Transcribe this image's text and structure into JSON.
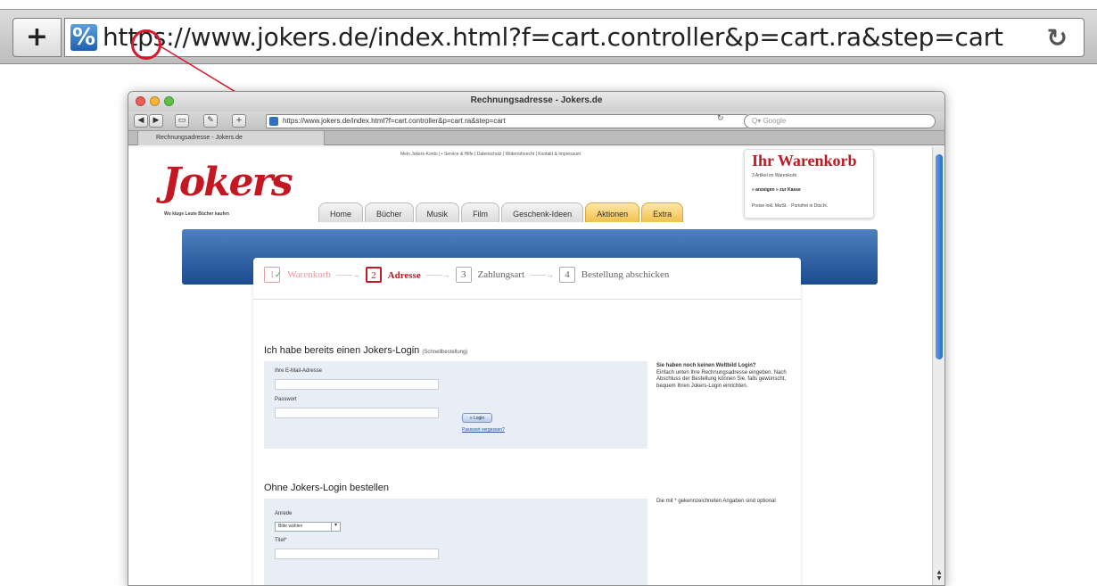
{
  "zoom_bar": {
    "plus_icon": "plus-icon",
    "security_badge": "%",
    "url": "https://www.jokers.de/index.html?f=cart.controller&p=cart.ra&step=cart",
    "reload_icon": "reload-icon",
    "highlight_color": "#d8172c"
  },
  "window": {
    "title": "Rechnungsadresse - Jokers.de",
    "url": "https://www.jokers.de/index.html?f=cart.controller&p=cart.ra&step=cart",
    "search_placeholder": "Q▾ Google",
    "tab_label": "Rechnungsadresse - Jokers.de"
  },
  "site": {
    "logo_text": "Jokers",
    "tagline": "Wo kluge Leute Bücher kaufen",
    "top_links": "Mein Jokers-Konto | • Service & Hilfe | Datenschutz | Widerrufsrecht | Kontakt & Impressum",
    "nav": [
      "Home",
      "Bücher",
      "Musik",
      "Film",
      "Geschenk-Ideen",
      "Aktionen",
      "Extra"
    ],
    "brand_color": "#c41722"
  },
  "cart": {
    "title": "Ihr Warenkorb",
    "items": "3 Artikel im Warenkorb",
    "actions": "» anzeigen  » zur Kasse",
    "footer": "Preise inkl. MwSt. · Portofrei in Dtschl."
  },
  "steps": [
    {
      "num": "1",
      "label": "Warenkorb",
      "state": "done"
    },
    {
      "num": "2",
      "label": "Adresse",
      "state": "active"
    },
    {
      "num": "3",
      "label": "Zahlungsart",
      "state": "pending"
    },
    {
      "num": "4",
      "label": "Bestellung abschicken",
      "state": "pending"
    }
  ],
  "login": {
    "heading": "Ich habe bereits einen Jokers-Login",
    "heading_note": "(Schnellbestellung)",
    "email_label": "Ihre E-Mail-Adresse",
    "password_label": "Passwort",
    "login_button": "» Login",
    "forgot_link": "Passwort vergessen?",
    "side_heading": "Sie haben noch keinen Weltbild Login?",
    "side_text": "Einfach unten Ihre Rechnungsadresse eingeben. Nach Abschluss der Bestellung können Sie, falls gewünscht, bequem Ihren Jokers-Login einrichten."
  },
  "guest": {
    "heading": "Ohne Jokers-Login bestellen",
    "salutation_label": "Anrede",
    "salutation_value": "Bitte wählen",
    "title_label": "Titel*",
    "side_text": "Die mit * gekennzeichneten Angaben sind optional"
  }
}
